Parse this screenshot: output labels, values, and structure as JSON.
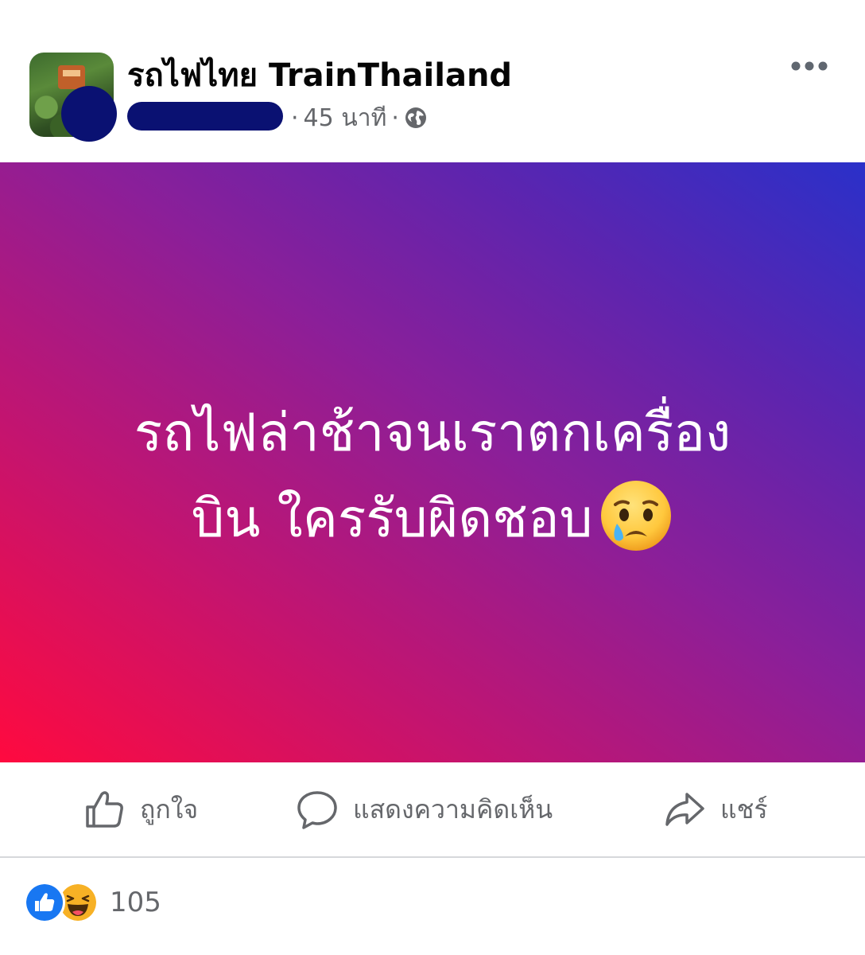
{
  "header": {
    "page_name": "รถไฟไทย TrainThailand",
    "separator": "·",
    "time_ago": "45 นาที",
    "separator2": "·",
    "privacy_icon": "globe-icon",
    "more_icon": "more-horizontal-icon",
    "redaction_color": "#0a1172"
  },
  "post": {
    "text_line1": "รถไฟล่าช้าจนเราตกเครื่อง",
    "text_line2": "บิน ใครรับผิดชอบ",
    "emoji": "sad-but-relieved-face-icon",
    "background_gradient": [
      "#ff0a3f",
      "#8b1f99",
      "#2a30c9"
    ]
  },
  "actions": {
    "like_label": "ถูกใจ",
    "comment_label": "แสดงความคิดเห็น",
    "share_label": "แชร์"
  },
  "reactions": {
    "icons": [
      "like-reaction-icon",
      "haha-reaction-icon"
    ],
    "count": "105"
  },
  "colors": {
    "text_primary": "#050505",
    "text_secondary": "#65676b",
    "like_blue": "#1877f2"
  }
}
